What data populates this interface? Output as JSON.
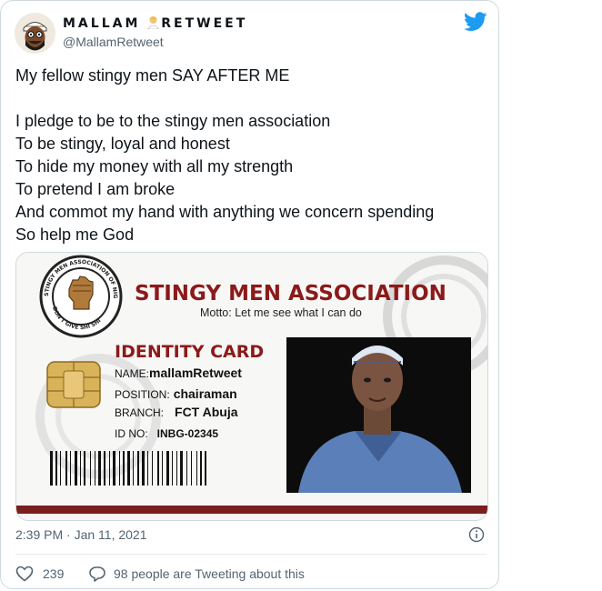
{
  "author": {
    "name": "MALLAM",
    "name_suffix": "RETWEET",
    "handle": "@MallamRetweet"
  },
  "tweet": {
    "lines": [
      "My fellow stingy men SAY AFTER ME",
      "",
      "I pledge to be to the stingy men association",
      "To be stingy, loyal and honest",
      "To hide my money with all my strength",
      "To pretend I am broke",
      "And commot my hand with anything we concern spending",
      "So help me God"
    ],
    "timestamp": "2:39 PM · Jan 11, 2021",
    "likes": "239",
    "replies_text": "98 people are Tweeting about this"
  },
  "card": {
    "title": "STINGY MEN ASSOCIATION",
    "motto": "Motto: Let me see what I can do",
    "id_heading": "IDENTITY CARD",
    "name_label": "NAME:",
    "name_value": "mallamRetweet",
    "position_label": "POSITION:",
    "position_value": "chairaman",
    "branch_label": "BRANCH:",
    "branch_value": "FCT Abuja",
    "idno_label": "ID NO:",
    "idno_value": "INBG-02345",
    "seal_text_top": "STINGY MEN ASSOCIATION OF NIGERIA",
    "seal_text_bottom": "DON'T GIVE SHI SHI"
  },
  "colors": {
    "brand_red": "#8b1a1a",
    "twitter_blue": "#1d9bf0",
    "text_primary": "#0f1419",
    "text_secondary": "#536471"
  },
  "icons": {
    "bird": "twitter-bird-icon",
    "info": "info-icon",
    "like": "heart-icon",
    "reply": "speech-bubble-icon",
    "emoji": "person-emoji-icon"
  }
}
